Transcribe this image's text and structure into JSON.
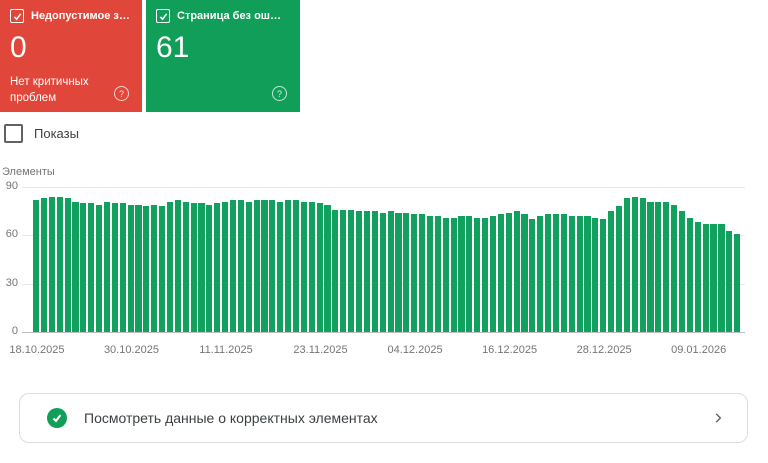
{
  "colors": {
    "error_card": "#e0473a",
    "valid_card": "#119e58",
    "bar": "#12a05e",
    "gridline": "#e6e6e6",
    "chevron": "#5f6368"
  },
  "cards": {
    "error": {
      "label": "Недопустимое з…",
      "value": "0",
      "subtitle": "Нет критичных проблем",
      "help_glyph": "?"
    },
    "valid": {
      "label": "Страница без ош…",
      "value": "61",
      "help_glyph": "?"
    }
  },
  "impressions_toggle": {
    "label": "Показы",
    "checked": false
  },
  "chart_data": {
    "type": "bar",
    "title": "Элементы",
    "ylabel": "Элементы",
    "ylim": [
      0,
      90
    ],
    "yticks": [
      0,
      30,
      60,
      90
    ],
    "grid": true,
    "bar_unit": "1 bar = 1 day",
    "x_ticks": [
      {
        "day": 0,
        "label": "18.10.2025"
      },
      {
        "day": 12,
        "label": "30.10.2025"
      },
      {
        "day": 24,
        "label": "11.11.2025"
      },
      {
        "day": 36,
        "label": "23.11.2025"
      },
      {
        "day": 48,
        "label": "04.12.2025"
      },
      {
        "day": 60,
        "label": "16.12.2025"
      },
      {
        "day": 72,
        "label": "28.12.2025"
      },
      {
        "day": 84,
        "label": "09.01.2026"
      }
    ],
    "values": [
      82,
      83,
      84,
      84,
      83,
      81,
      80,
      80,
      79,
      81,
      80,
      80,
      79,
      79,
      78,
      79,
      78,
      81,
      82,
      81,
      80,
      80,
      79,
      80,
      81,
      82,
      82,
      81,
      82,
      82,
      82,
      81,
      82,
      82,
      81,
      81,
      80,
      79,
      76,
      76,
      76,
      75,
      75,
      75,
      74,
      75,
      74,
      74,
      73,
      73,
      72,
      72,
      71,
      71,
      72,
      72,
      71,
      71,
      72,
      73,
      74,
      75,
      73,
      70,
      72,
      73,
      73,
      73,
      72,
      72,
      72,
      71,
      70,
      75,
      78,
      83,
      84,
      83,
      81,
      81,
      81,
      79,
      75,
      71,
      68,
      67,
      67,
      67,
      63,
      61
    ]
  },
  "footer": {
    "label": "Посмотреть данные о корректных элементах"
  }
}
